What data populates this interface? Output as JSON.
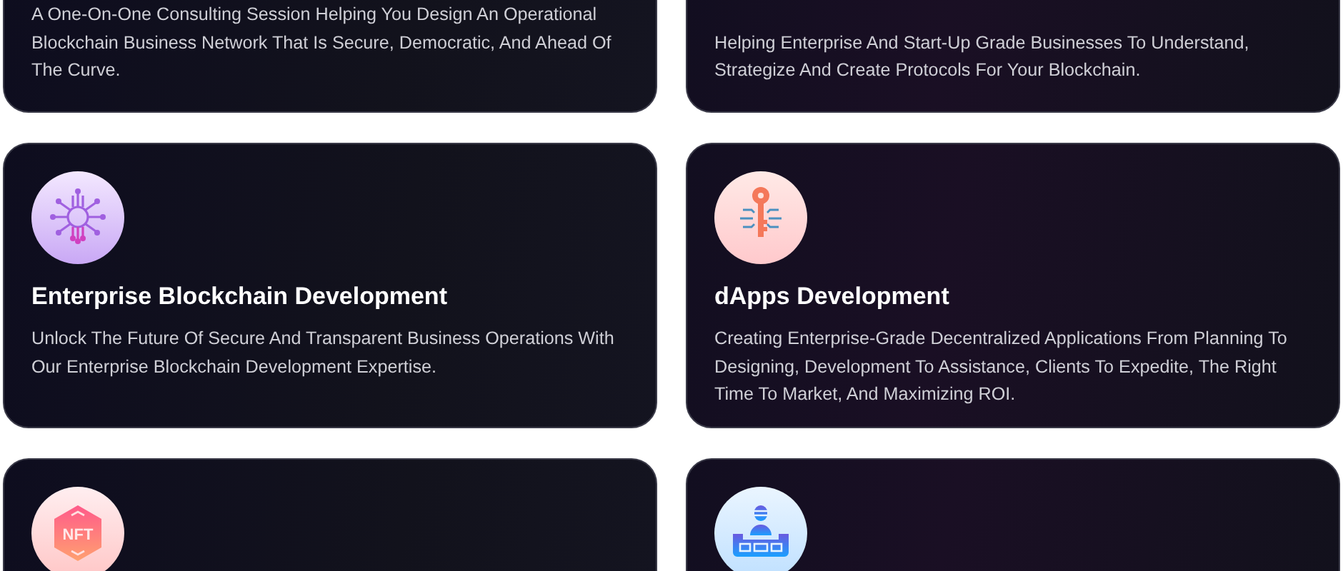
{
  "cards": [
    {
      "description": "A One-On-One Consulting Session Helping You Design An Operational Blockchain Business Network That Is Secure, Democratic, And Ahead Of The Curve."
    },
    {
      "description": "Helping Enterprise And Start-Up Grade Businesses To Understand, Strategize And Create Protocols For Your Blockchain."
    },
    {
      "icon": {
        "kind": "network"
      },
      "title": "Enterprise Blockchain Development",
      "description": "Unlock The Future Of Secure And Transparent Business Operations With Our Enterprise Blockchain Development Expertise."
    },
    {
      "icon": {
        "kind": "key"
      },
      "title": "dApps Development",
      "description": "Creating Enterprise-Grade Decentralized Applications From Planning To Designing, Development To Assistance, Clients To Expedite, The Right Time To Market, And Maximizing ROI."
    },
    {
      "icon": {
        "kind": "nft",
        "text": "NFT"
      }
    },
    {
      "icon": {
        "kind": "kiosk"
      }
    }
  ]
}
